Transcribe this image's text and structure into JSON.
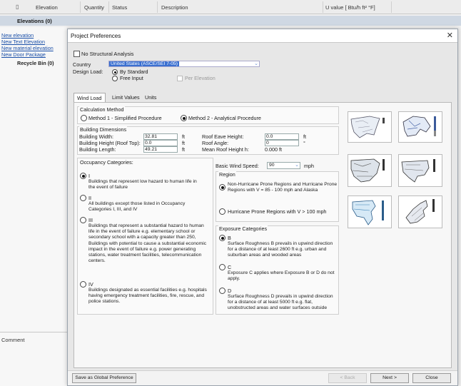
{
  "app": {
    "columns": {
      "elevation": "Elevation",
      "quantity": "Quantity",
      "status": "Status",
      "description": "Description",
      "uvalue": "U value [ Btu/h ft² °F]"
    },
    "elevations_header": "Elevations (0)",
    "sidebar_links": [
      "New elevation",
      "New Text Elevation",
      "New material elevation",
      "New Door Package"
    ],
    "recycle_bin": "Recycle Bin (0)",
    "comment_label": "Comment"
  },
  "dialog": {
    "title": "Project Preferences",
    "no_structural_label": "No Structural Analysis",
    "country_label": "Country",
    "country_value": "United States (ASCE/SEI 7-05)",
    "design_load_label": "Design Load:",
    "by_standard": "By Standard",
    "free_input": "Free Input",
    "per_elevation": "Per Elevation",
    "tabs": [
      "Wind Load",
      "Limit Values",
      "Units"
    ],
    "calc_method": {
      "title": "Calculation Method",
      "method1": "Method 1 - Simplified Procedure",
      "method2": "Method 2 - Analytical Procedure"
    },
    "dimensions": {
      "title": "Building Dimensions",
      "width_label": "Building Width:",
      "width_value": "32.81",
      "height_label": "Building Height (Roof Top):",
      "height_value": "0.0",
      "length_label": "Building Length:",
      "length_value": "49.21",
      "unit_ft": "ft",
      "eave_label": "Roof Eave Height:",
      "eave_value": "0.0",
      "angle_label": "Roof Angle:",
      "angle_value": "0",
      "angle_unit": "°",
      "mean_label": "Mean Roof Height h:",
      "mean_value": "0.000 ft"
    },
    "occupancy": {
      "title": "Occupancy Categories:",
      "items": [
        {
          "label": "I",
          "desc": "Buildings that represent low hazard to human life in the event of failure"
        },
        {
          "label": "II",
          "desc": "All buildings except those listed in Occupancy Categories I, III, and IV"
        },
        {
          "label": "III",
          "desc": "Buildings that represent a substantial hazard to human life in the event of failure e.g. elementary school or secondary school with a capacity greater than 250, Buildings with potential to cause a substantial economic impact in the event of failure e.g. power generating stations, water treatment facilities, telecommunication centers."
        },
        {
          "label": "IV",
          "desc": "Buildings designated as essential facilities e.g. hospitals having emergency treatment facilities, fire, rescue, and police stations."
        }
      ]
    },
    "wind": {
      "speed_label": "Basic Wind Speed:",
      "speed_value": "90",
      "speed_unit": "mph",
      "region_title": "Region",
      "region1": "Non-Hurricane Prone Regions and Hurricane Prone Regions with V = 85 - 100 mph and Alaska",
      "region2": "Hurricane Prone Regions with V > 100 mph"
    },
    "exposure": {
      "title": "Exposure Categories",
      "items": [
        {
          "label": "B",
          "desc": "Surface Roughness B prevails in upwind direction for a distance of at least 2600 ft e.g. urban and suburban areas and wooded areas"
        },
        {
          "label": "C",
          "desc": "Exposure C applies where Exposure B or D do not apply."
        },
        {
          "label": "D",
          "desc": "Surface Roughness D prevails in upwind direction for a distance of at least 5000 ft e.g. flat, unobstructed areas and water surfaces outside"
        }
      ]
    },
    "footer": {
      "save_global": "Save as Global Preference",
      "back": "< Back",
      "next": "Next >",
      "close": "Close"
    }
  }
}
